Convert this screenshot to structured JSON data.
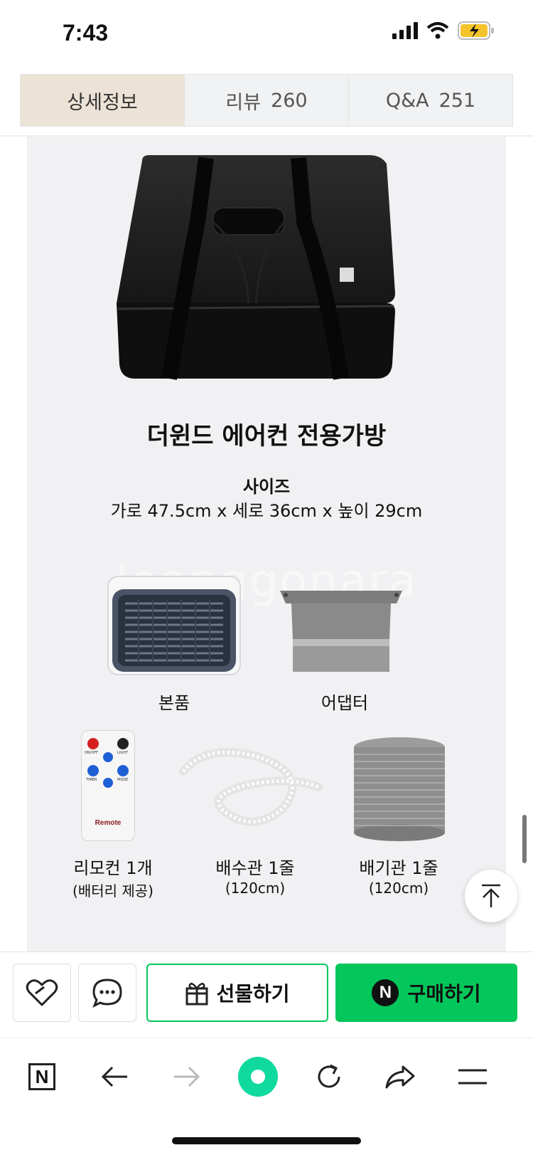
{
  "status_bar": {
    "time": "7:43"
  },
  "tabs": [
    {
      "label": "상세정보",
      "count": ""
    },
    {
      "label": "리뷰",
      "count": "260"
    },
    {
      "label": "Q&A",
      "count": "251"
    }
  ],
  "product": {
    "title": "더윈드 에어컨 전용가방",
    "size_heading": "사이즈",
    "size_value": "가로 47.5cm x 세로 36cm x 높이 29cm",
    "watermark": "Joonggonara",
    "components": [
      {
        "label": "본품"
      },
      {
        "label": "어댑터"
      },
      {
        "label": "리모컨 1개",
        "sub": "(배터리 제공)"
      },
      {
        "label": "배수관 1줄",
        "sub": "(120cm)"
      },
      {
        "label": "배기관 1줄",
        "sub": "(120cm)"
      }
    ],
    "remote_label": "Remote",
    "remote_buttons": [
      "ON/OFF",
      "LIGHT",
      "TIMER",
      "MODE"
    ]
  },
  "buy_bar": {
    "gift_label": "선물하기",
    "buy_label": "구매하기",
    "n_mark": "N"
  },
  "toolbar": {
    "n_mark": "N"
  },
  "colors": {
    "naver_green": "#03c75a",
    "active_tab": "#ece3d6",
    "panel_bg": "#f1f1f3"
  }
}
